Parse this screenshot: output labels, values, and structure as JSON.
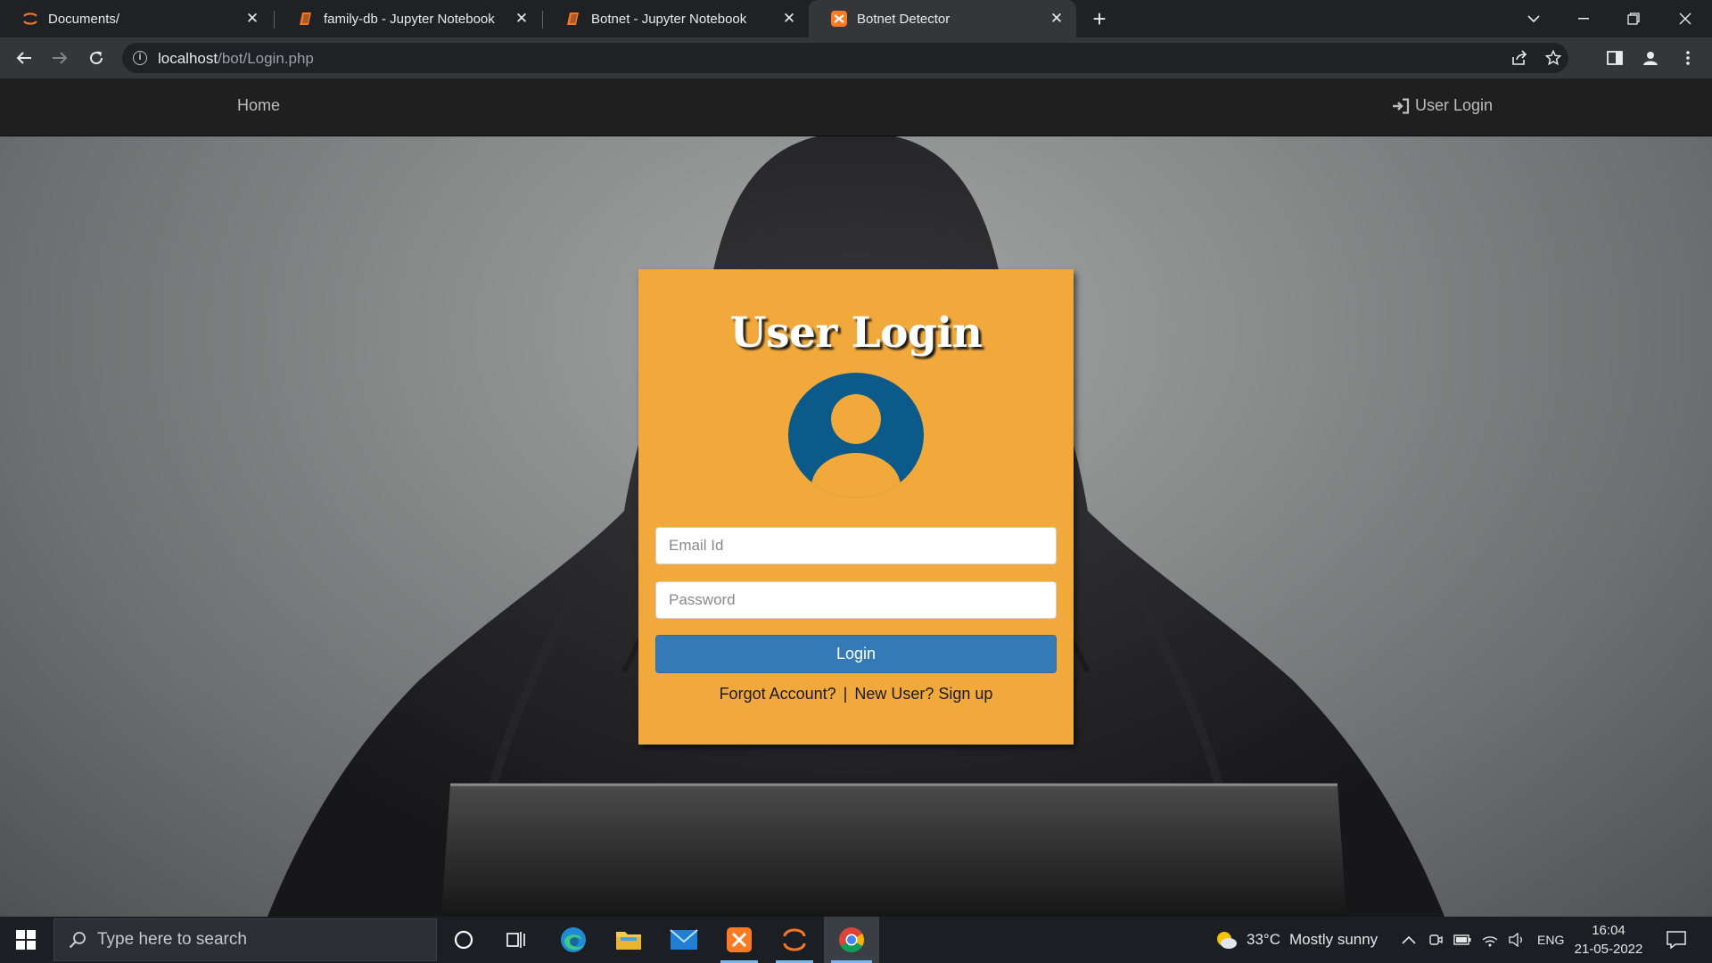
{
  "browser": {
    "tabs": [
      {
        "title": "Documents/",
        "icon": "jupyter-icon"
      },
      {
        "title": "family-db - Jupyter Notebook",
        "icon": "notebook-icon"
      },
      {
        "title": "Botnet - Jupyter Notebook",
        "icon": "notebook-icon"
      },
      {
        "title": "Botnet Detector",
        "icon": "xampp-icon",
        "active": true
      }
    ],
    "url_host": "localhost",
    "url_path": "/bot/Login.php"
  },
  "navbar": {
    "home_label": "Home",
    "login_label": "User Login"
  },
  "login_card": {
    "title": "User Login",
    "email_placeholder": "Email Id",
    "password_placeholder": "Password",
    "login_button": "Login",
    "forgot_link": "Forgot Account?",
    "separator": "|",
    "signup_link": "New User? Sign up",
    "card_color": "#f2a93b",
    "button_color": "#337ab7",
    "avatar_color": "#0b5a8a"
  },
  "taskbar": {
    "search_placeholder": "Type here to search",
    "weather_temp": "33°C",
    "weather_text": "Mostly sunny",
    "language": "ENG",
    "time": "16:04",
    "date": "21-05-2022"
  }
}
